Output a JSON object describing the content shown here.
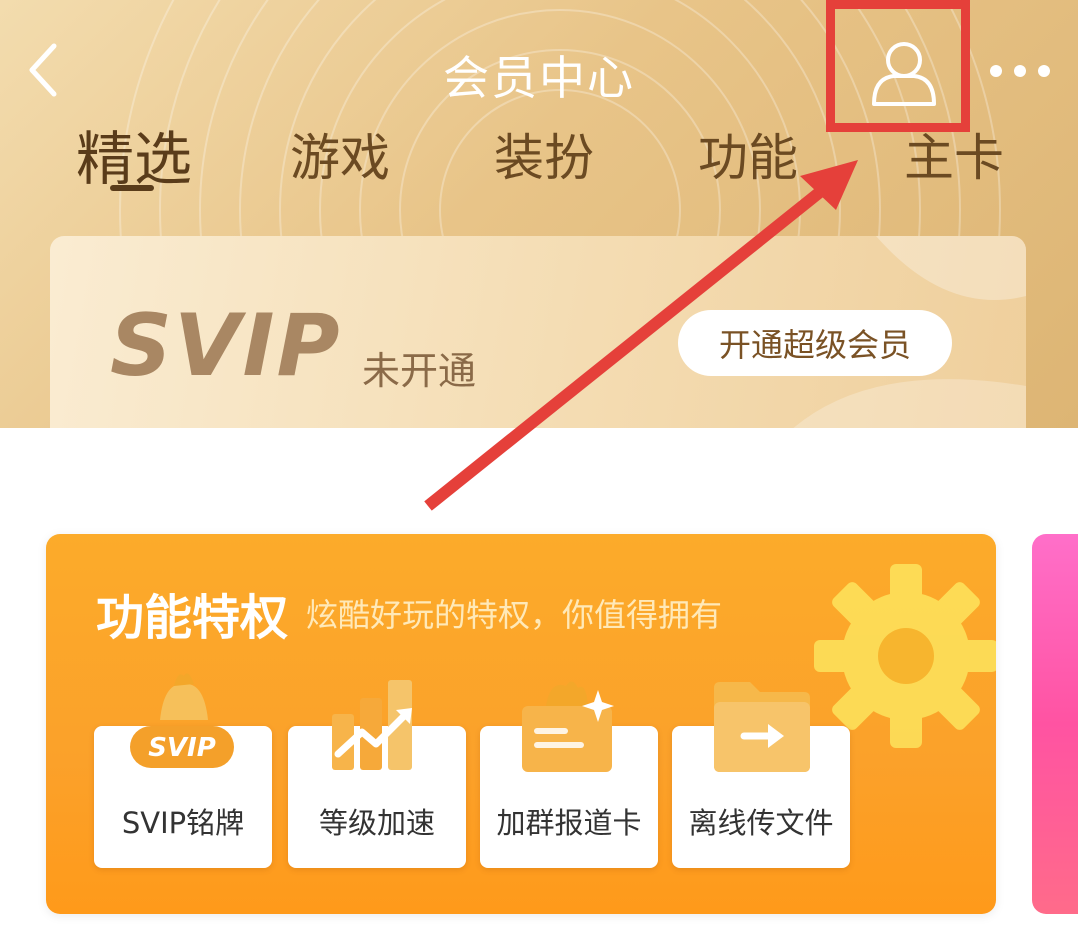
{
  "header": {
    "title": "会员中心",
    "back_icon": "chevron-left-icon",
    "user_icon": "user-icon",
    "more_icon": "more-dots-icon"
  },
  "tabs": [
    {
      "label": "精选",
      "active": true
    },
    {
      "label": "游戏",
      "active": false
    },
    {
      "label": "装扮",
      "active": false
    },
    {
      "label": "功能",
      "active": false
    },
    {
      "label": "主卡",
      "active": false
    }
  ],
  "svip_card": {
    "logo": "SVIP",
    "status": "未开通",
    "button_label": "开通超级会员"
  },
  "feature_section": {
    "title": "功能特权",
    "subtitle": "炫酷好玩的特权，你值得拥有",
    "items": [
      {
        "label": "SVIP铭牌",
        "icon": "svip-badge-icon",
        "icon_text": "SVIP"
      },
      {
        "label": "等级加速",
        "icon": "level-boost-icon"
      },
      {
        "label": "加群报道卡",
        "icon": "group-card-icon"
      },
      {
        "label": "离线传文件",
        "icon": "offline-file-icon"
      }
    ]
  },
  "colors": {
    "header_gold": "#e8c488",
    "feature_orange": "#fba12a",
    "annotation_red": "#e5403a",
    "pink_card": "#ff53a2"
  }
}
